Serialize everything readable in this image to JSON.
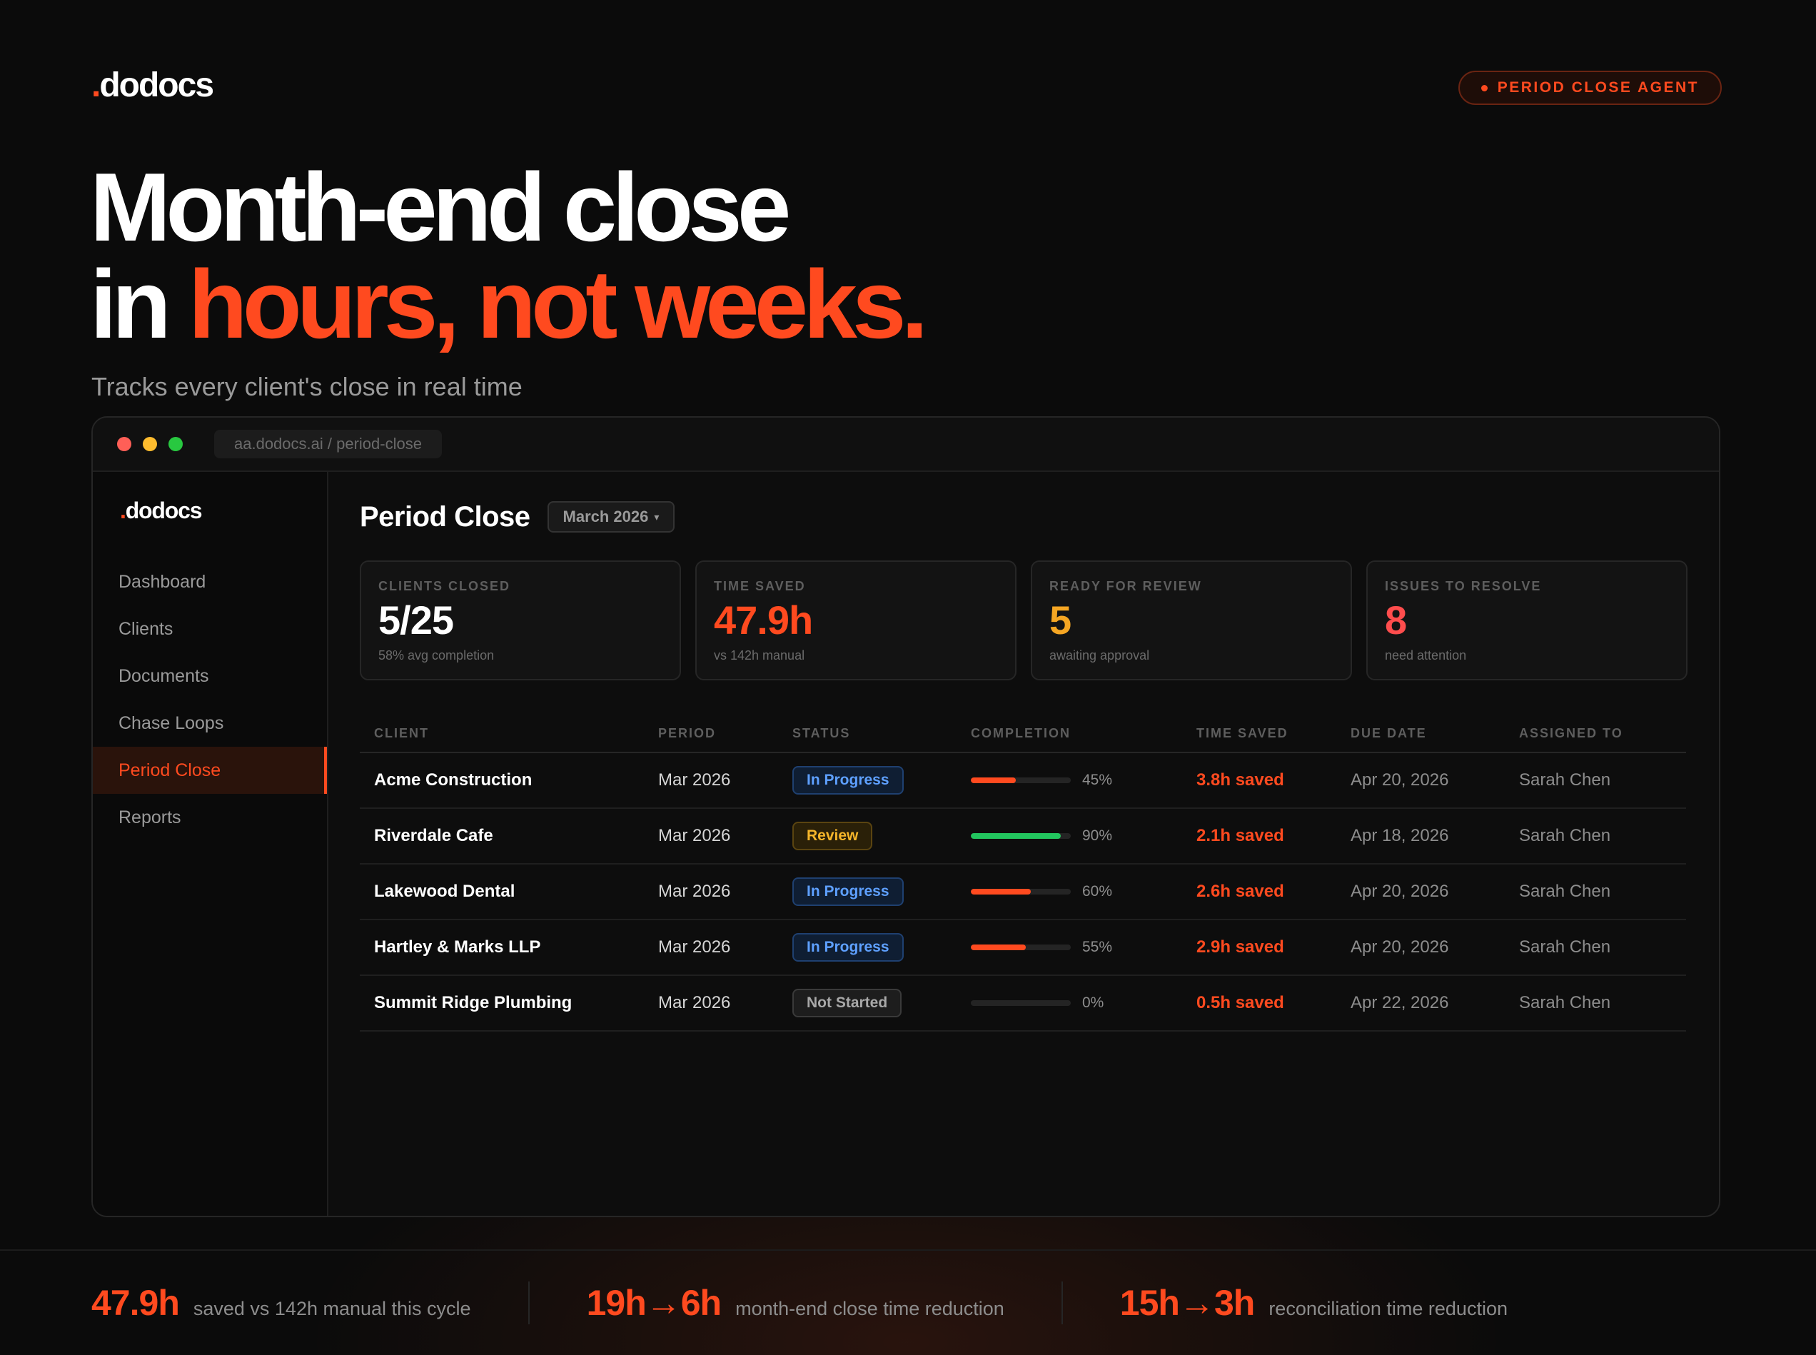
{
  "brand": {
    "dot": ".",
    "name": "dodocs"
  },
  "agent_badge": "PERIOD CLOSE AGENT",
  "hero": {
    "line1": "Month-end close",
    "line2_prefix": "in ",
    "line2_accent": "hours, not weeks."
  },
  "subtitle": "Tracks every client's close in real time",
  "window": {
    "url": "aa.dodocs.ai / period-close"
  },
  "sidebar": {
    "items": [
      {
        "label": "Dashboard"
      },
      {
        "label": "Clients"
      },
      {
        "label": "Documents"
      },
      {
        "label": "Chase Loops"
      },
      {
        "label": "Period Close",
        "active": true
      },
      {
        "label": "Reports"
      }
    ]
  },
  "main": {
    "title": "Period Close",
    "period_selected": "March 2026",
    "caret": "▾"
  },
  "stats": [
    {
      "label": "CLIENTS CLOSED",
      "value": "5/25",
      "sub": "58% avg completion",
      "color": "#ffffff"
    },
    {
      "label": "TIME SAVED",
      "value": "47.9h",
      "sub": "vs 142h manual",
      "color": "#ff4a1f"
    },
    {
      "label": "READY FOR REVIEW",
      "value": "5",
      "sub": "awaiting approval",
      "color": "#f5a623"
    },
    {
      "label": "ISSUES TO RESOLVE",
      "value": "8",
      "sub": "need attention",
      "color": "#ff4d4d"
    }
  ],
  "table": {
    "headers": {
      "client": "CLIENT",
      "period": "PERIOD",
      "status": "STATUS",
      "completion": "COMPLETION",
      "time_saved": "TIME SAVED",
      "due_date": "DUE DATE",
      "assigned_to": "ASSIGNED TO"
    },
    "rows": [
      {
        "client": "Acme Construction",
        "period": "Mar 2026",
        "status": "In Progress",
        "status_kind": "progress",
        "completion": 45,
        "completion_label": "45%",
        "bar_color": "#ff4a1f",
        "time_saved": "3.8h saved",
        "due": "Apr 20, 2026",
        "assigned": "Sarah Chen"
      },
      {
        "client": "Riverdale Cafe",
        "period": "Mar 2026",
        "status": "Review",
        "status_kind": "review",
        "completion": 90,
        "completion_label": "90%",
        "bar_color": "#22c55e",
        "time_saved": "2.1h saved",
        "due": "Apr 18, 2026",
        "assigned": "Sarah Chen"
      },
      {
        "client": "Lakewood Dental",
        "period": "Mar 2026",
        "status": "In Progress",
        "status_kind": "progress",
        "completion": 60,
        "completion_label": "60%",
        "bar_color": "#ff4a1f",
        "time_saved": "2.6h saved",
        "due": "Apr 20, 2026",
        "assigned": "Sarah Chen"
      },
      {
        "client": "Hartley & Marks LLP",
        "period": "Mar 2026",
        "status": "In Progress",
        "status_kind": "progress",
        "completion": 55,
        "completion_label": "55%",
        "bar_color": "#ff4a1f",
        "time_saved": "2.9h saved",
        "due": "Apr 20, 2026",
        "assigned": "Sarah Chen"
      },
      {
        "client": "Summit Ridge Plumbing",
        "period": "Mar 2026",
        "status": "Not Started",
        "status_kind": "notstarted",
        "completion": 0,
        "completion_label": "0%",
        "bar_color": "#ff4a1f",
        "time_saved": "0.5h saved",
        "due": "Apr 22, 2026",
        "assigned": "Sarah Chen"
      }
    ]
  },
  "bottom_stats": [
    {
      "value": "47.9h",
      "text": "saved vs 142h manual this cycle"
    },
    {
      "value": "19h→6h",
      "text": "month-end close time reduction"
    },
    {
      "value": "15h→3h",
      "text": "reconciliation time reduction"
    }
  ],
  "colors": {
    "accent": "#ff4a1f",
    "background": "#0b0b0b"
  }
}
